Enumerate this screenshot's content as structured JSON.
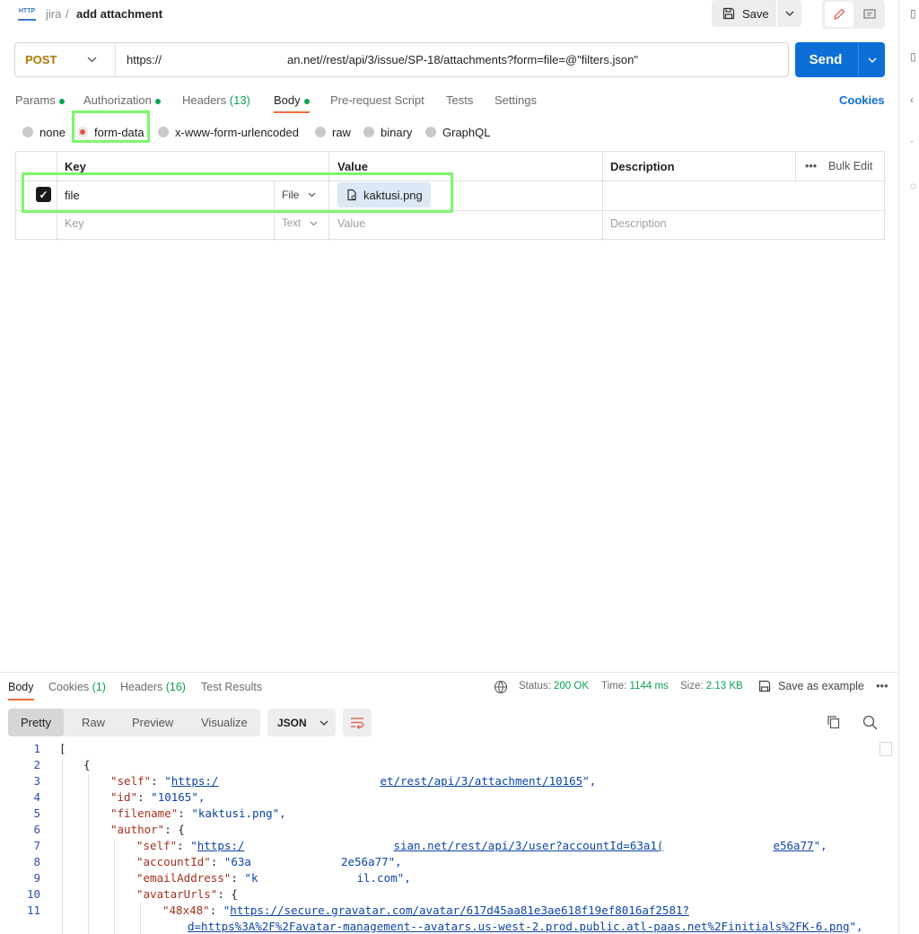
{
  "header": {
    "icon_label": "HTTP",
    "parent": "jira",
    "separator": "/",
    "title": "add attachment",
    "save_label": "Save"
  },
  "request": {
    "method": "POST",
    "url_start": "https://",
    "url_rest": "an.net//rest/api/3/issue/SP-18/attachments?form=file=@\"filters.json\"",
    "send_label": "Send"
  },
  "tabs": [
    {
      "label": "Params",
      "dot": true
    },
    {
      "label": "Authorization",
      "dot": true
    },
    {
      "label": "Headers",
      "count": "(13)"
    },
    {
      "label": "Body",
      "dot": true
    },
    {
      "label": "Pre-request Script"
    },
    {
      "label": "Tests"
    },
    {
      "label": "Settings"
    }
  ],
  "cookies_label": "Cookies",
  "body_types": [
    "none",
    "form-data",
    "x-www-form-urlencoded",
    "raw",
    "binary",
    "GraphQL"
  ],
  "body_type_selected": "form-data",
  "table": {
    "headers": {
      "key": "Key",
      "value": "Value",
      "description": "Description",
      "bulk_edit": "Bulk Edit"
    },
    "rows": [
      {
        "checked": true,
        "key": "file",
        "type": "File",
        "value": "kaktusi.png",
        "description": ""
      }
    ],
    "placeholder": {
      "key": "Key",
      "type": "Text",
      "value": "Value",
      "description": "Description"
    }
  },
  "response": {
    "tabs": [
      {
        "label": "Body"
      },
      {
        "label": "Cookies",
        "count": "(1)"
      },
      {
        "label": "Headers",
        "count": "(16)"
      },
      {
        "label": "Test Results"
      }
    ],
    "status_label": "Status:",
    "status_value": "200 OK",
    "time_label": "Time:",
    "time_value": "1144 ms",
    "size_label": "Size:",
    "size_value": "2.13 KB",
    "save_example": "Save as example",
    "formats": [
      "Pretty",
      "Raw",
      "Preview",
      "Visualize"
    ],
    "format_selected": "Pretty",
    "language": "JSON"
  },
  "code": {
    "line_numbers": [
      "1",
      "2",
      "3",
      "4",
      "5",
      "6",
      "7",
      "8",
      "9",
      "10",
      "11"
    ],
    "l1": "[",
    "l2": "{",
    "l3_key": "\"self\"",
    "l3_val_a": "\"",
    "l3_url_a": "https:/",
    "l3_url_b": "et/rest/api/3/attachment/10165",
    "l3_end": "\",",
    "l4_key": "\"id\"",
    "l4_val": "\"10165\",",
    "l5_key": "\"filename\"",
    "l5_val": "\"kaktusi.png\",",
    "l6_key": "\"author\"",
    "l6_rest": ": {",
    "l7_key": "\"self\"",
    "l7_url_a": "https:/",
    "l7_url_b": "sian.net/rest/api/3/user?accountId=63a1(",
    "l7_url_c": "e56a77",
    "l7_end": "\",",
    "l8_key": "\"accountId\"",
    "l8_val_a": "\"63a",
    "l8_val_b": "2e56a77\",",
    "l9_key": "\"emailAddress\"",
    "l9_val_a": "\"k",
    "l9_val_b": "il.com\",",
    "l10_key": "\"avatarUrls\"",
    "l10_rest": ": {",
    "l11_key": "\"48x48\"",
    "l11_url_a": "https://secure.gravatar.com/avatar/617d45aa81e3ae618f19ef8016af2581?",
    "l11_url_b": "d=https%3A%2F%2Favatar-management--avatars.us-west-2.prod.public.atl-paas.net%2Finitials%2FK-6.png",
    "l11_end": "\","
  }
}
